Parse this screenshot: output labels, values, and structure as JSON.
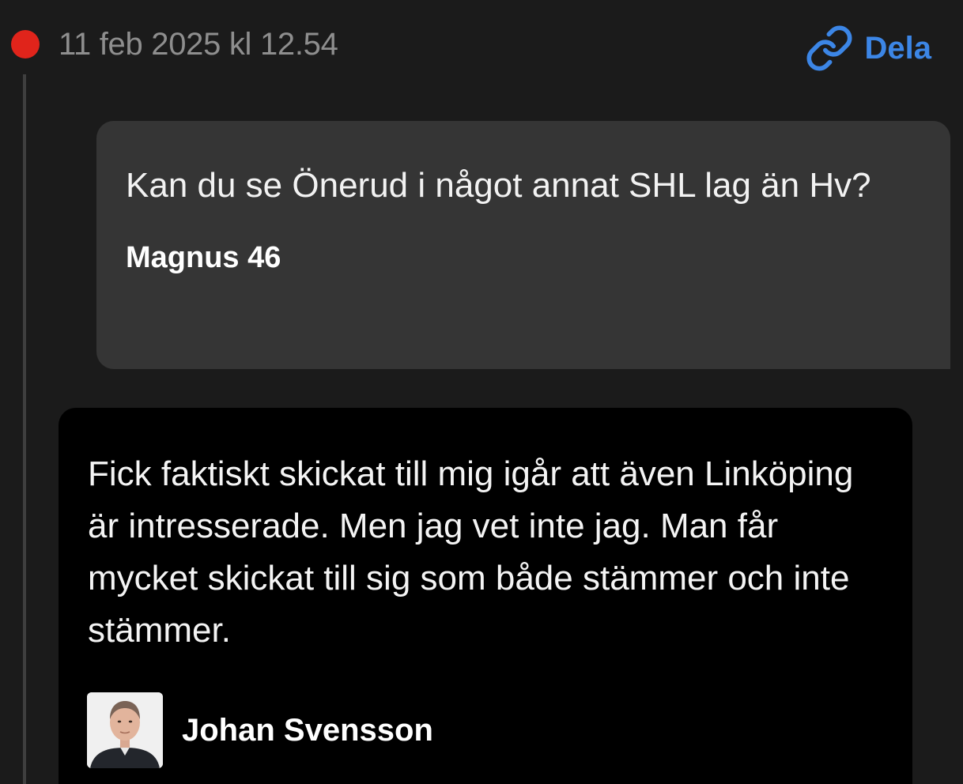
{
  "header": {
    "timestamp": "11 feb 2025 kl 12.54",
    "share_label": "Dela",
    "share_icon": "link-icon",
    "live_dot_color": "#e0241b",
    "accent_color": "#3c86e6"
  },
  "question": {
    "text": "Kan du se Önerud i något annat SHL lag än Hv?",
    "author": "Magnus 46"
  },
  "answer": {
    "text": "Fick faktiskt skickat till mig igår att även Linköping är intresserade. Men jag vet inte jag. Man får mycket skickat till sig som både stämmer och inte stämmer.",
    "author": "Johan Svensson",
    "avatar_icon": "person-avatar"
  }
}
